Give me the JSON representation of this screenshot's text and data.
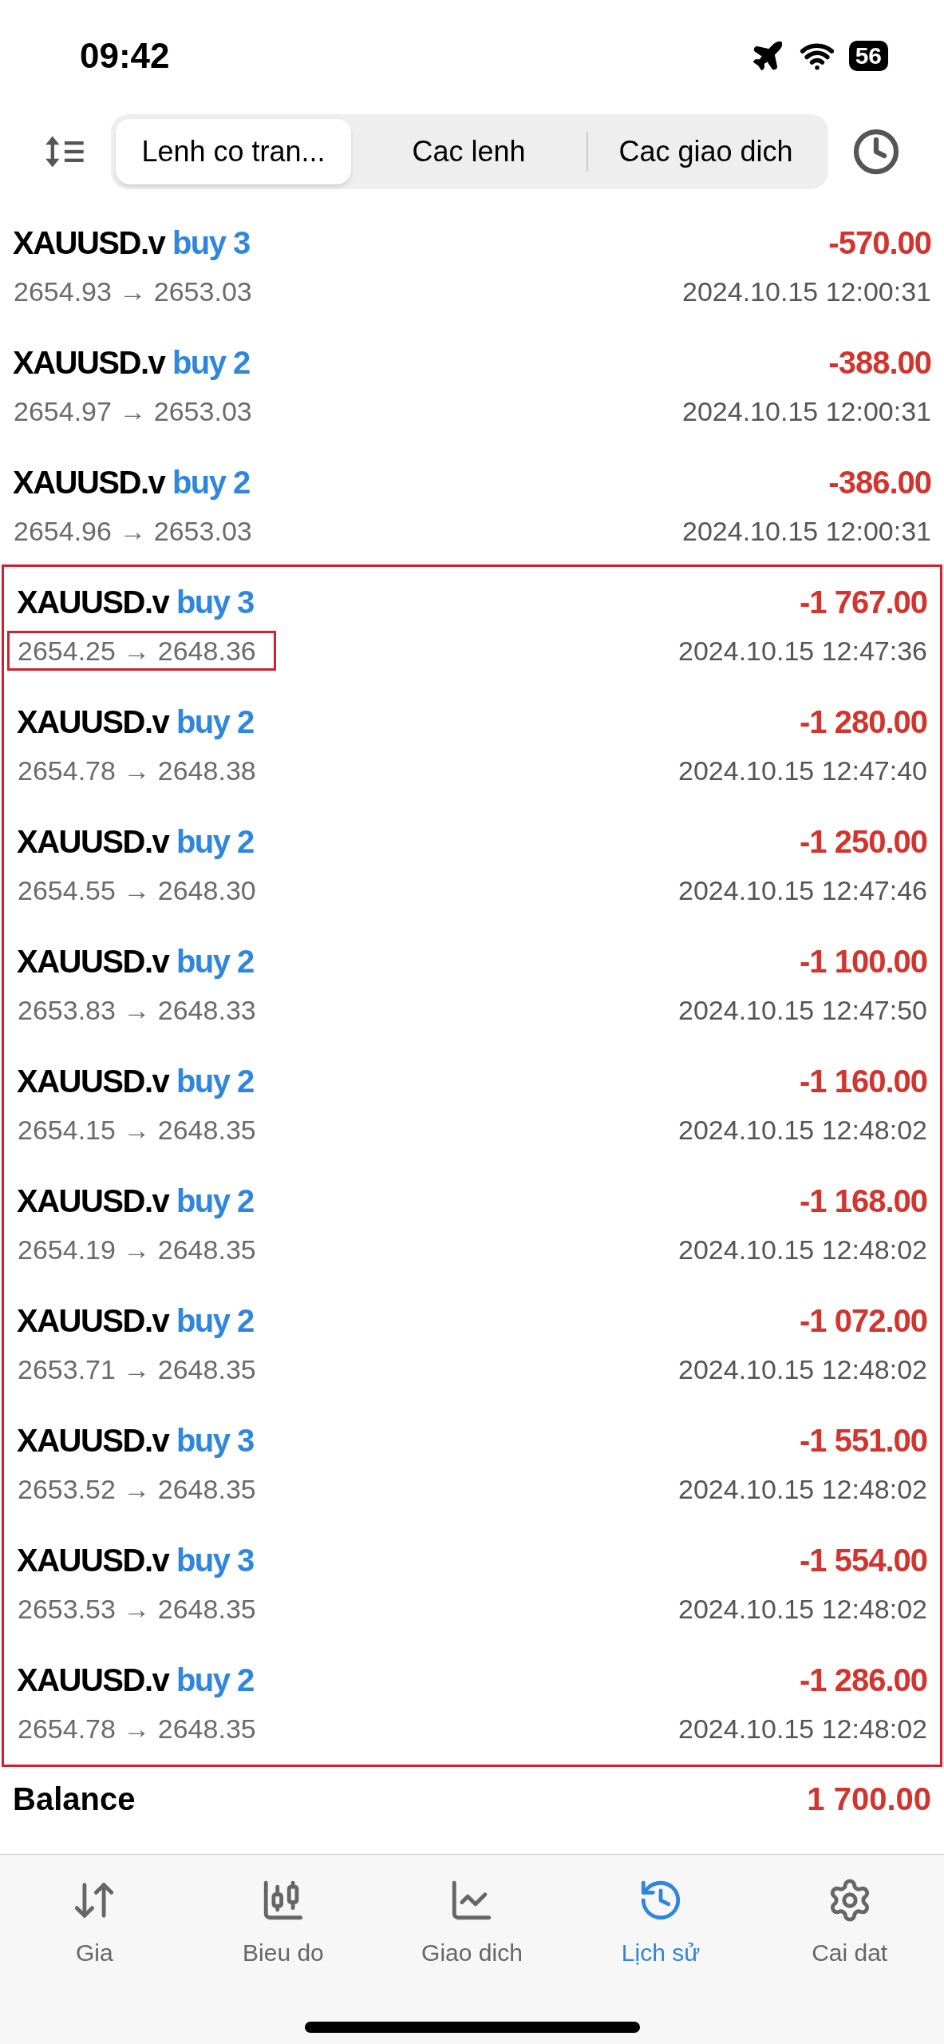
{
  "status_bar": {
    "time": "09:42",
    "battery": "56"
  },
  "tabs": [
    {
      "label": "Lenh co tran...",
      "selected": true
    },
    {
      "label": "Cac lenh",
      "selected": false
    },
    {
      "label": "Cac giao dich",
      "selected": false
    }
  ],
  "trades": [
    {
      "symbol": "XAUUSD.v",
      "side": "buy 3",
      "profit": "-570.00",
      "prices": "2654.93 → 2653.03",
      "time": "2024.10.15 12:00:31",
      "price_marked": false
    },
    {
      "symbol": "XAUUSD.v",
      "side": "buy 2",
      "profit": "-388.00",
      "prices": "2654.97 → 2653.03",
      "time": "2024.10.15 12:00:31",
      "price_marked": false
    },
    {
      "symbol": "XAUUSD.v",
      "side": "buy 2",
      "profit": "-386.00",
      "prices": "2654.96 → 2653.03",
      "time": "2024.10.15 12:00:31",
      "price_marked": false
    }
  ],
  "marked_trades": [
    {
      "symbol": "XAUUSD.v",
      "side": "buy 3",
      "profit": "-1 767.00",
      "prices": "2654.25 → 2648.36",
      "time": "2024.10.15 12:47:36",
      "price_marked": true
    },
    {
      "symbol": "XAUUSD.v",
      "side": "buy 2",
      "profit": "-1 280.00",
      "prices": "2654.78 → 2648.38",
      "time": "2024.10.15 12:47:40",
      "price_marked": false
    },
    {
      "symbol": "XAUUSD.v",
      "side": "buy 2",
      "profit": "-1 250.00",
      "prices": "2654.55 → 2648.30",
      "time": "2024.10.15 12:47:46",
      "price_marked": false
    },
    {
      "symbol": "XAUUSD.v",
      "side": "buy 2",
      "profit": "-1 100.00",
      "prices": "2653.83 → 2648.33",
      "time": "2024.10.15 12:47:50",
      "price_marked": false
    },
    {
      "symbol": "XAUUSD.v",
      "side": "buy 2",
      "profit": "-1 160.00",
      "prices": "2654.15 → 2648.35",
      "time": "2024.10.15 12:48:02",
      "price_marked": false
    },
    {
      "symbol": "XAUUSD.v",
      "side": "buy 2",
      "profit": "-1 168.00",
      "prices": "2654.19 → 2648.35",
      "time": "2024.10.15 12:48:02",
      "price_marked": false
    },
    {
      "symbol": "XAUUSD.v",
      "side": "buy 2",
      "profit": "-1 072.00",
      "prices": "2653.71 → 2648.35",
      "time": "2024.10.15 12:48:02",
      "price_marked": false
    },
    {
      "symbol": "XAUUSD.v",
      "side": "buy 3",
      "profit": "-1 551.00",
      "prices": "2653.52 → 2648.35",
      "time": "2024.10.15 12:48:02",
      "price_marked": false
    },
    {
      "symbol": "XAUUSD.v",
      "side": "buy 3",
      "profit": "-1 554.00",
      "prices": "2653.53 → 2648.35",
      "time": "2024.10.15 12:48:02",
      "price_marked": false
    },
    {
      "symbol": "XAUUSD.v",
      "side": "buy 2",
      "profit": "-1 286.00",
      "prices": "2654.78 → 2648.35",
      "time": "2024.10.15 12:48:02",
      "price_marked": false
    }
  ],
  "balance": {
    "label": "Balance",
    "value": "1 700.00"
  },
  "nav": [
    {
      "kind": "arrows",
      "label": "Gia",
      "selected": false
    },
    {
      "kind": "candles",
      "label": "Bieu do",
      "selected": false
    },
    {
      "kind": "chart",
      "label": "Giao dich",
      "selected": false
    },
    {
      "kind": "history",
      "label": "Lịch sử",
      "selected": true
    },
    {
      "kind": "gear",
      "label": "Cai dat",
      "selected": false
    }
  ]
}
